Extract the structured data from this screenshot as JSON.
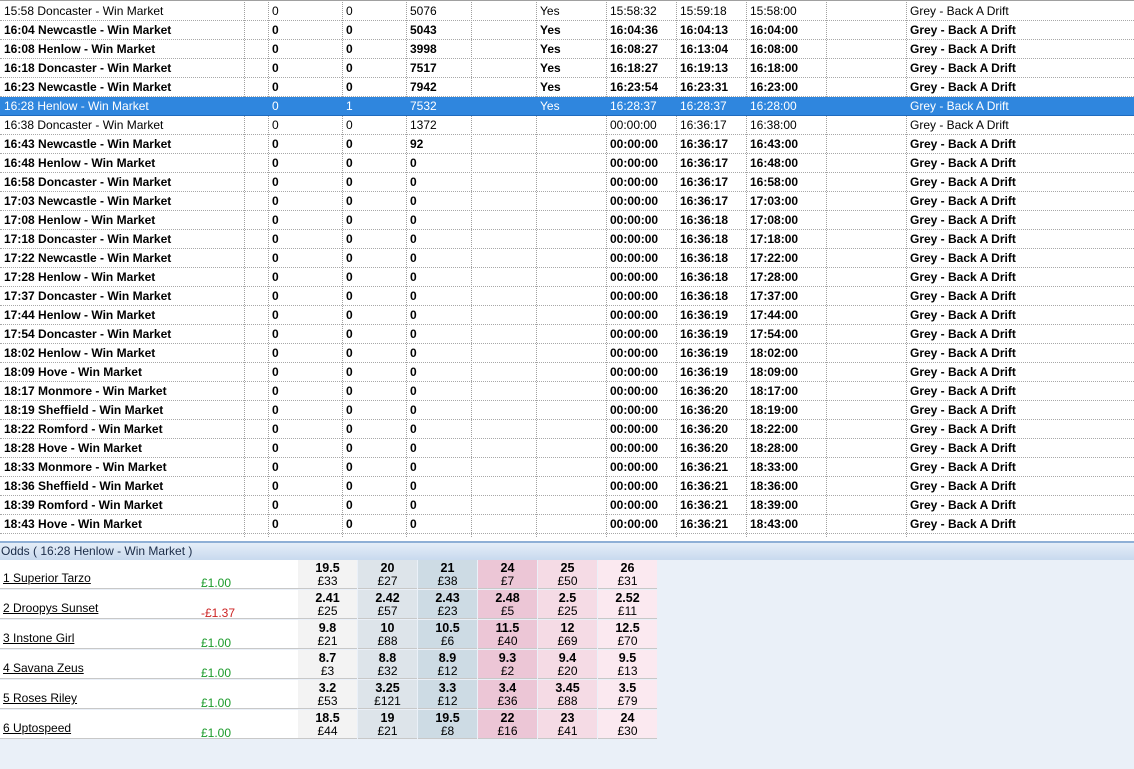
{
  "markets": [
    {
      "name": "15:58 Doncaster - Win Market",
      "a": "0",
      "b": "0",
      "c": "5076",
      "d": "",
      "e": "Yes",
      "f": "15:58:32",
      "g": "15:59:18",
      "h": "15:58:00",
      "i": "",
      "j": "Grey - Back A Drift",
      "bold": false,
      "selected": false
    },
    {
      "name": "16:04 Newcastle - Win Market",
      "a": "0",
      "b": "0",
      "c": "5043",
      "d": "",
      "e": "Yes",
      "f": "16:04:36",
      "g": "16:04:13",
      "h": "16:04:00",
      "i": "",
      "j": "Grey - Back A Drift",
      "bold": true,
      "selected": false
    },
    {
      "name": "16:08 Henlow - Win Market",
      "a": "0",
      "b": "0",
      "c": "3998",
      "d": "",
      "e": "Yes",
      "f": "16:08:27",
      "g": "16:13:04",
      "h": "16:08:00",
      "i": "",
      "j": "Grey - Back A Drift",
      "bold": true,
      "selected": false
    },
    {
      "name": "16:18 Doncaster - Win Market",
      "a": "0",
      "b": "0",
      "c": "7517",
      "d": "",
      "e": "Yes",
      "f": "16:18:27",
      "g": "16:19:13",
      "h": "16:18:00",
      "i": "",
      "j": "Grey - Back A Drift",
      "bold": true,
      "selected": false
    },
    {
      "name": "16:23 Newcastle - Win Market",
      "a": "0",
      "b": "0",
      "c": "7942",
      "d": "",
      "e": "Yes",
      "f": "16:23:54",
      "g": "16:23:31",
      "h": "16:23:00",
      "i": "",
      "j": "Grey - Back A Drift",
      "bold": true,
      "selected": false
    },
    {
      "name": "16:28 Henlow - Win Market",
      "a": "0",
      "b": "1",
      "c": "7532",
      "d": "",
      "e": "Yes",
      "f": "16:28:37",
      "g": "16:28:37",
      "h": "16:28:00",
      "i": "",
      "j": "Grey - Back A Drift",
      "bold": false,
      "selected": true
    },
    {
      "name": "16:38 Doncaster - Win Market",
      "a": "0",
      "b": "0",
      "c": "1372",
      "d": "",
      "e": "",
      "f": "00:00:00",
      "g": "16:36:17",
      "h": "16:38:00",
      "i": "",
      "j": "Grey - Back A Drift",
      "bold": false,
      "selected": false
    },
    {
      "name": "16:43 Newcastle - Win Market",
      "a": "0",
      "b": "0",
      "c": "92",
      "d": "",
      "e": "",
      "f": "00:00:00",
      "g": "16:36:17",
      "h": "16:43:00",
      "i": "",
      "j": "Grey - Back A Drift",
      "bold": true,
      "selected": false
    },
    {
      "name": "16:48 Henlow - Win Market",
      "a": "0",
      "b": "0",
      "c": "0",
      "d": "",
      "e": "",
      "f": "00:00:00",
      "g": "16:36:17",
      "h": "16:48:00",
      "i": "",
      "j": "Grey - Back A Drift",
      "bold": true,
      "selected": false
    },
    {
      "name": "16:58 Doncaster - Win Market",
      "a": "0",
      "b": "0",
      "c": "0",
      "d": "",
      "e": "",
      "f": "00:00:00",
      "g": "16:36:17",
      "h": "16:58:00",
      "i": "",
      "j": "Grey - Back A Drift",
      "bold": true,
      "selected": false
    },
    {
      "name": "17:03 Newcastle - Win Market",
      "a": "0",
      "b": "0",
      "c": "0",
      "d": "",
      "e": "",
      "f": "00:00:00",
      "g": "16:36:17",
      "h": "17:03:00",
      "i": "",
      "j": "Grey - Back A Drift",
      "bold": true,
      "selected": false
    },
    {
      "name": "17:08 Henlow - Win Market",
      "a": "0",
      "b": "0",
      "c": "0",
      "d": "",
      "e": "",
      "f": "00:00:00",
      "g": "16:36:18",
      "h": "17:08:00",
      "i": "",
      "j": "Grey - Back A Drift",
      "bold": true,
      "selected": false
    },
    {
      "name": "17:18 Doncaster - Win Market",
      "a": "0",
      "b": "0",
      "c": "0",
      "d": "",
      "e": "",
      "f": "00:00:00",
      "g": "16:36:18",
      "h": "17:18:00",
      "i": "",
      "j": "Grey - Back A Drift",
      "bold": true,
      "selected": false
    },
    {
      "name": "17:22 Newcastle - Win Market",
      "a": "0",
      "b": "0",
      "c": "0",
      "d": "",
      "e": "",
      "f": "00:00:00",
      "g": "16:36:18",
      "h": "17:22:00",
      "i": "",
      "j": "Grey - Back A Drift",
      "bold": true,
      "selected": false
    },
    {
      "name": "17:28 Henlow - Win Market",
      "a": "0",
      "b": "0",
      "c": "0",
      "d": "",
      "e": "",
      "f": "00:00:00",
      "g": "16:36:18",
      "h": "17:28:00",
      "i": "",
      "j": "Grey - Back A Drift",
      "bold": true,
      "selected": false
    },
    {
      "name": "17:37 Doncaster - Win Market",
      "a": "0",
      "b": "0",
      "c": "0",
      "d": "",
      "e": "",
      "f": "00:00:00",
      "g": "16:36:18",
      "h": "17:37:00",
      "i": "",
      "j": "Grey - Back A Drift",
      "bold": true,
      "selected": false
    },
    {
      "name": "17:44 Henlow - Win Market",
      "a": "0",
      "b": "0",
      "c": "0",
      "d": "",
      "e": "",
      "f": "00:00:00",
      "g": "16:36:19",
      "h": "17:44:00",
      "i": "",
      "j": "Grey - Back A Drift",
      "bold": true,
      "selected": false
    },
    {
      "name": "17:54 Doncaster - Win Market",
      "a": "0",
      "b": "0",
      "c": "0",
      "d": "",
      "e": "",
      "f": "00:00:00",
      "g": "16:36:19",
      "h": "17:54:00",
      "i": "",
      "j": "Grey - Back A Drift",
      "bold": true,
      "selected": false
    },
    {
      "name": "18:02 Henlow - Win Market",
      "a": "0",
      "b": "0",
      "c": "0",
      "d": "",
      "e": "",
      "f": "00:00:00",
      "g": "16:36:19",
      "h": "18:02:00",
      "i": "",
      "j": "Grey - Back A Drift",
      "bold": true,
      "selected": false
    },
    {
      "name": "18:09 Hove - Win Market",
      "a": "0",
      "b": "0",
      "c": "0",
      "d": "",
      "e": "",
      "f": "00:00:00",
      "g": "16:36:19",
      "h": "18:09:00",
      "i": "",
      "j": "Grey - Back A Drift",
      "bold": true,
      "selected": false
    },
    {
      "name": "18:17 Monmore - Win Market",
      "a": "0",
      "b": "0",
      "c": "0",
      "d": "",
      "e": "",
      "f": "00:00:00",
      "g": "16:36:20",
      "h": "18:17:00",
      "i": "",
      "j": "Grey - Back A Drift",
      "bold": true,
      "selected": false
    },
    {
      "name": "18:19 Sheffield - Win Market",
      "a": "0",
      "b": "0",
      "c": "0",
      "d": "",
      "e": "",
      "f": "00:00:00",
      "g": "16:36:20",
      "h": "18:19:00",
      "i": "",
      "j": "Grey - Back A Drift",
      "bold": true,
      "selected": false
    },
    {
      "name": "18:22 Romford - Win Market",
      "a": "0",
      "b": "0",
      "c": "0",
      "d": "",
      "e": "",
      "f": "00:00:00",
      "g": "16:36:20",
      "h": "18:22:00",
      "i": "",
      "j": "Grey - Back A Drift",
      "bold": true,
      "selected": false
    },
    {
      "name": "18:28 Hove - Win Market",
      "a": "0",
      "b": "0",
      "c": "0",
      "d": "",
      "e": "",
      "f": "00:00:00",
      "g": "16:36:20",
      "h": "18:28:00",
      "i": "",
      "j": "Grey - Back A Drift",
      "bold": true,
      "selected": false
    },
    {
      "name": "18:33 Monmore - Win Market",
      "a": "0",
      "b": "0",
      "c": "0",
      "d": "",
      "e": "",
      "f": "00:00:00",
      "g": "16:36:21",
      "h": "18:33:00",
      "i": "",
      "j": "Grey - Back A Drift",
      "bold": true,
      "selected": false
    },
    {
      "name": "18:36 Sheffield - Win Market",
      "a": "0",
      "b": "0",
      "c": "0",
      "d": "",
      "e": "",
      "f": "00:00:00",
      "g": "16:36:21",
      "h": "18:36:00",
      "i": "",
      "j": "Grey - Back A Drift",
      "bold": true,
      "selected": false
    },
    {
      "name": "18:39 Romford - Win Market",
      "a": "0",
      "b": "0",
      "c": "0",
      "d": "",
      "e": "",
      "f": "00:00:00",
      "g": "16:36:21",
      "h": "18:39:00",
      "i": "",
      "j": "Grey - Back A Drift",
      "bold": true,
      "selected": false
    },
    {
      "name": "18:43 Hove - Win Market",
      "a": "0",
      "b": "0",
      "c": "0",
      "d": "",
      "e": "",
      "f": "00:00:00",
      "g": "16:36:21",
      "h": "18:43:00",
      "i": "",
      "j": "Grey - Back A Drift",
      "bold": true,
      "selected": false
    }
  ],
  "odds_panel": {
    "title": "Odds ( 16:28 Henlow - Win Market )",
    "colors": {
      "positive": "#1a9a2a",
      "negative": "#cc2222",
      "selected_row": "#2f86de"
    },
    "runners": [
      {
        "name": "1 Superior Tarzo",
        "pl": "£1.00",
        "pl_sign": "pos",
        "prices": [
          {
            "p": "19.5",
            "s": "£33"
          },
          {
            "p": "20",
            "s": "£27"
          },
          {
            "p": "21",
            "s": "£38"
          },
          {
            "p": "24",
            "s": "£7"
          },
          {
            "p": "25",
            "s": "£50"
          },
          {
            "p": "26",
            "s": "£31"
          }
        ]
      },
      {
        "name": "2 Droopys Sunset",
        "pl": "-£1.37",
        "pl_sign": "neg",
        "prices": [
          {
            "p": "2.41",
            "s": "£25"
          },
          {
            "p": "2.42",
            "s": "£57"
          },
          {
            "p": "2.43",
            "s": "£23"
          },
          {
            "p": "2.48",
            "s": "£5"
          },
          {
            "p": "2.5",
            "s": "£25"
          },
          {
            "p": "2.52",
            "s": "£11"
          }
        ]
      },
      {
        "name": "3 Instone Girl",
        "pl": "£1.00",
        "pl_sign": "pos",
        "prices": [
          {
            "p": "9.8",
            "s": "£21"
          },
          {
            "p": "10",
            "s": "£88"
          },
          {
            "p": "10.5",
            "s": "£6"
          },
          {
            "p": "11.5",
            "s": "£40"
          },
          {
            "p": "12",
            "s": "£69"
          },
          {
            "p": "12.5",
            "s": "£70"
          }
        ]
      },
      {
        "name": "4 Savana Zeus",
        "pl": "£1.00",
        "pl_sign": "pos",
        "prices": [
          {
            "p": "8.7",
            "s": "£3"
          },
          {
            "p": "8.8",
            "s": "£32"
          },
          {
            "p": "8.9",
            "s": "£12"
          },
          {
            "p": "9.3",
            "s": "£2"
          },
          {
            "p": "9.4",
            "s": "£20"
          },
          {
            "p": "9.5",
            "s": "£13"
          }
        ]
      },
      {
        "name": "5 Roses Riley",
        "pl": "£1.00",
        "pl_sign": "pos",
        "prices": [
          {
            "p": "3.2",
            "s": "£53"
          },
          {
            "p": "3.25",
            "s": "£121"
          },
          {
            "p": "3.3",
            "s": "£12"
          },
          {
            "p": "3.4",
            "s": "£36"
          },
          {
            "p": "3.45",
            "s": "£88"
          },
          {
            "p": "3.5",
            "s": "£79"
          }
        ]
      },
      {
        "name": "6 Uptospeed",
        "pl": "£1.00",
        "pl_sign": "pos",
        "prices": [
          {
            "p": "18.5",
            "s": "£44"
          },
          {
            "p": "19",
            "s": "£21"
          },
          {
            "p": "19.5",
            "s": "£8"
          },
          {
            "p": "22",
            "s": "£16"
          },
          {
            "p": "23",
            "s": "£41"
          },
          {
            "p": "24",
            "s": "£30"
          }
        ]
      }
    ]
  }
}
